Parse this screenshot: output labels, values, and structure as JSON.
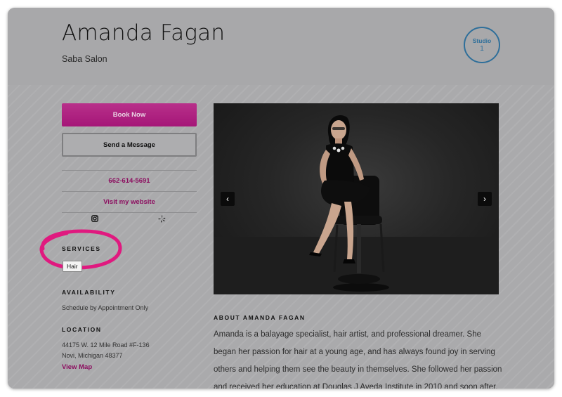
{
  "header": {
    "name": "Amanda Fagan",
    "salon": "Saba Salon",
    "studio_label": "Studio",
    "studio_number": "1"
  },
  "sidebar": {
    "book_label": "Book Now",
    "message_label": "Send a Message",
    "phone": "662-614-5691",
    "website_label": "Visit my website",
    "social_icons": [
      "instagram-icon",
      "yelp-icon"
    ],
    "services_title": "SERVICES",
    "services": [
      "Hair"
    ],
    "availability_title": "AVAILABILITY",
    "availability": "Schedule by Appointment Only",
    "location_title": "LOCATION",
    "address_line1": "44175 W. 12 Mile Road #F-136",
    "address_line2": "Novi, Michigan 48377",
    "map_label": "View Map"
  },
  "main": {
    "prev_icon": "chevron-left-icon",
    "next_icon": "chevron-right-icon",
    "about_title": "ABOUT AMANDA FAGAN",
    "about_text": "Amanda is a balayage specialist, hair artist, and professional dreamer. She began her passion for hair at a young age, and has always found joy in serving others and helping them see the beauty in themselves. She followed her passion and received her education at Douglas J Aveda Institute in 2010 and soon after,"
  },
  "colors": {
    "accent": "#a51678",
    "link": "#8c0d5f",
    "badge": "#2f6f9a",
    "highlight": "#e0197f"
  }
}
